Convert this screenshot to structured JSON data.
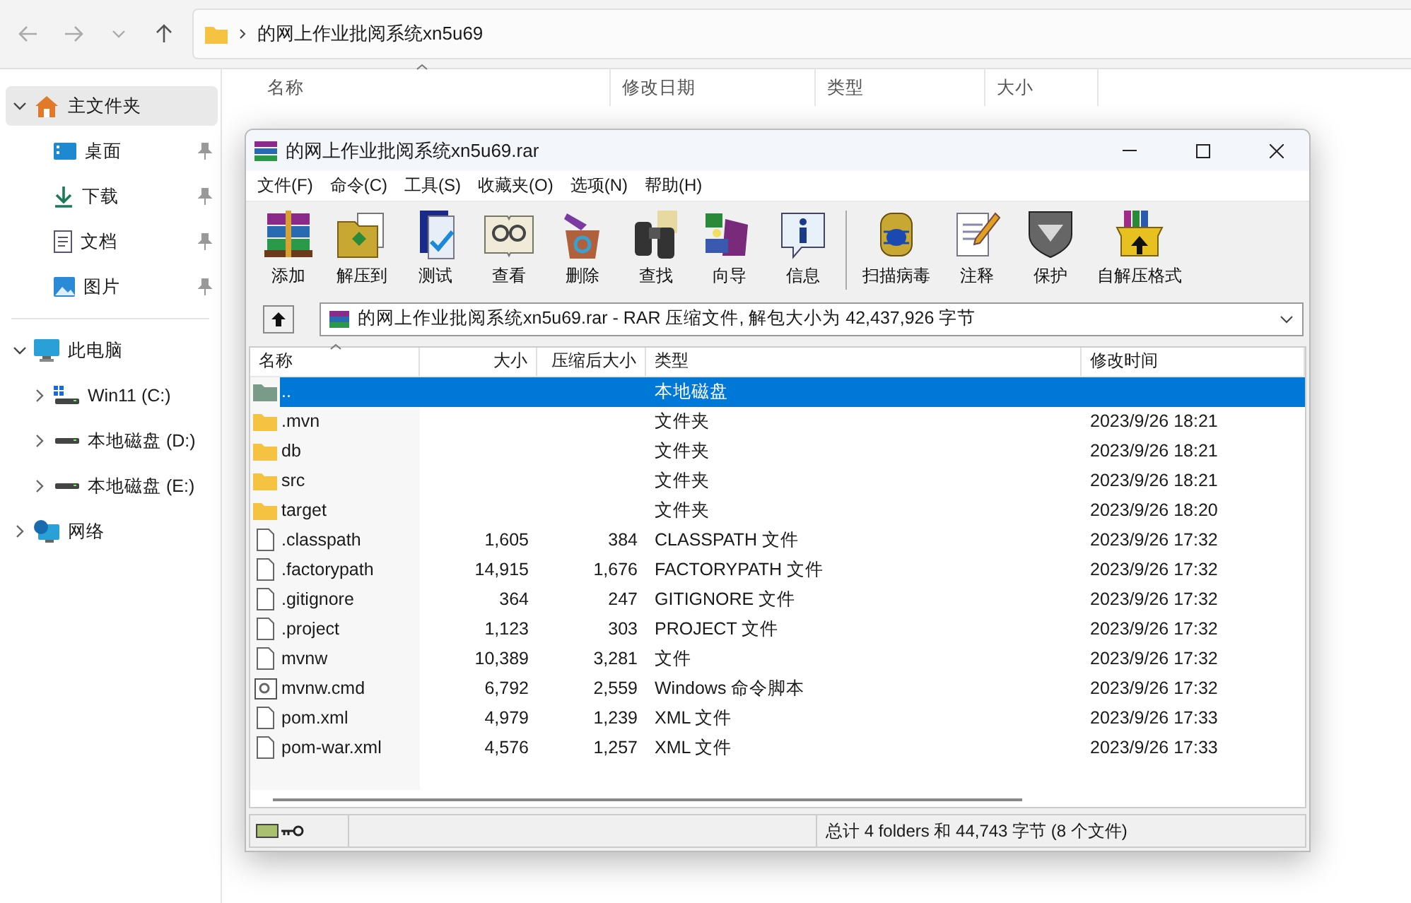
{
  "explorer": {
    "address": {
      "path": "的网上作业批阅系统xn5u69"
    },
    "sidebar": {
      "home": {
        "label": "主文件夹",
        "expanded": true,
        "selected": true
      },
      "pinned": [
        {
          "label": "桌面",
          "kind": "desktop",
          "pinned": true
        },
        {
          "label": "下载",
          "kind": "download",
          "pinned": true
        },
        {
          "label": "文档",
          "kind": "document",
          "pinned": true
        },
        {
          "label": "图片",
          "kind": "picture",
          "pinned": true
        }
      ],
      "tree": [
        {
          "label": "此电脑",
          "kind": "pc",
          "expanded": true,
          "selected": false,
          "children": [
            {
              "label": "Win11 (C:)",
              "kind": "system_drive",
              "expanded": false,
              "selected": false
            },
            {
              "label": "本地磁盘 (D:)",
              "kind": "drive",
              "expanded": false,
              "selected": false
            },
            {
              "label": "本地磁盘 (E:)",
              "kind": "drive",
              "expanded": false,
              "selected": false
            }
          ]
        },
        {
          "label": "网络",
          "kind": "network",
          "expanded": false,
          "selected": false
        }
      ]
    },
    "columns": [
      {
        "label": "名称",
        "sorted": true
      },
      {
        "label": "修改日期",
        "sorted": false
      },
      {
        "label": "类型",
        "sorted": false
      },
      {
        "label": "大小",
        "sorted": false
      }
    ]
  },
  "archiver": {
    "window": {
      "title": "的网上作业批阅系统xn5u69.rar"
    },
    "menu": [
      "文件(F)",
      "命令(C)",
      "工具(S)",
      "收藏夹(O)",
      "选项(N)",
      "帮助(H)"
    ],
    "toolbar": [
      {
        "label": "添加",
        "kind": "add",
        "separator_before": false
      },
      {
        "label": "解压到",
        "kind": "extract",
        "separator_before": false
      },
      {
        "label": "测试",
        "kind": "test",
        "separator_before": false
      },
      {
        "label": "查看",
        "kind": "view",
        "separator_before": false
      },
      {
        "label": "删除",
        "kind": "delete",
        "separator_before": false
      },
      {
        "label": "查找",
        "kind": "find",
        "separator_before": false
      },
      {
        "label": "向导",
        "kind": "wizard",
        "separator_before": false
      },
      {
        "label": "信息",
        "kind": "info",
        "separator_before": false
      },
      {
        "label": "扫描病毒",
        "kind": "scan",
        "separator_before": true
      },
      {
        "label": "注释",
        "kind": "comment",
        "separator_before": false
      },
      {
        "label": "保护",
        "kind": "protect",
        "separator_before": false
      },
      {
        "label": "自解压格式",
        "kind": "sfx",
        "separator_before": false
      }
    ],
    "address": {
      "value": "的网上作业批阅系统xn5u69.rar - RAR 压缩文件, 解包大小为 42,437,926 字节"
    },
    "table": {
      "columns": [
        {
          "label": "名称",
          "sorted": true
        },
        {
          "label": "大小",
          "sorted": false
        },
        {
          "label": "压缩后大小",
          "sorted": false
        },
        {
          "label": "类型",
          "sorted": false
        },
        {
          "label": "修改时间",
          "sorted": false
        }
      ],
      "rows": [
        {
          "name": "..",
          "type": "本地磁盘",
          "kind": "parent",
          "selected": true
        },
        {
          "name": ".mvn",
          "type": "文件夹",
          "modified": "2023/9/26 18:21",
          "kind": "folder",
          "selected": false
        },
        {
          "name": "db",
          "type": "文件夹",
          "modified": "2023/9/26 18:21",
          "kind": "folder",
          "selected": false
        },
        {
          "name": "src",
          "type": "文件夹",
          "modified": "2023/9/26 18:21",
          "kind": "folder",
          "selected": false
        },
        {
          "name": "target",
          "type": "文件夹",
          "modified": "2023/9/26 18:20",
          "kind": "folder",
          "selected": false
        },
        {
          "name": ".classpath",
          "size": "1,605",
          "packed": "384",
          "type": "CLASSPATH 文件",
          "modified": "2023/9/26 17:32",
          "kind": "file",
          "selected": false
        },
        {
          "name": ".factorypath",
          "size": "14,915",
          "packed": "1,676",
          "type": "FACTORYPATH 文件",
          "modified": "2023/9/26 17:32",
          "kind": "file",
          "selected": false
        },
        {
          "name": ".gitignore",
          "size": "364",
          "packed": "247",
          "type": "GITIGNORE 文件",
          "modified": "2023/9/26 17:32",
          "kind": "file",
          "selected": false
        },
        {
          "name": ".project",
          "size": "1,123",
          "packed": "303",
          "type": "PROJECT 文件",
          "modified": "2023/9/26 17:32",
          "kind": "file",
          "selected": false
        },
        {
          "name": "mvnw",
          "size": "10,389",
          "packed": "3,281",
          "type": "文件",
          "modified": "2023/9/26 17:32",
          "kind": "file",
          "selected": false
        },
        {
          "name": "mvnw.cmd",
          "size": "6,792",
          "packed": "2,559",
          "type": "Windows 命令脚本",
          "modified": "2023/9/26 17:32",
          "kind": "script",
          "selected": false
        },
        {
          "name": "pom.xml",
          "size": "4,979",
          "packed": "1,239",
          "type": "XML 文件",
          "modified": "2023/9/26 17:33",
          "kind": "file",
          "selected": false
        },
        {
          "name": "pom-war.xml",
          "size": "4,576",
          "packed": "1,257",
          "type": "XML 文件",
          "modified": "2023/9/26 17:33",
          "kind": "file",
          "selected": false
        }
      ]
    },
    "status_bar": {
      "text": "总计 4 folders 和 44,743 字节 (8 个文件)"
    }
  }
}
